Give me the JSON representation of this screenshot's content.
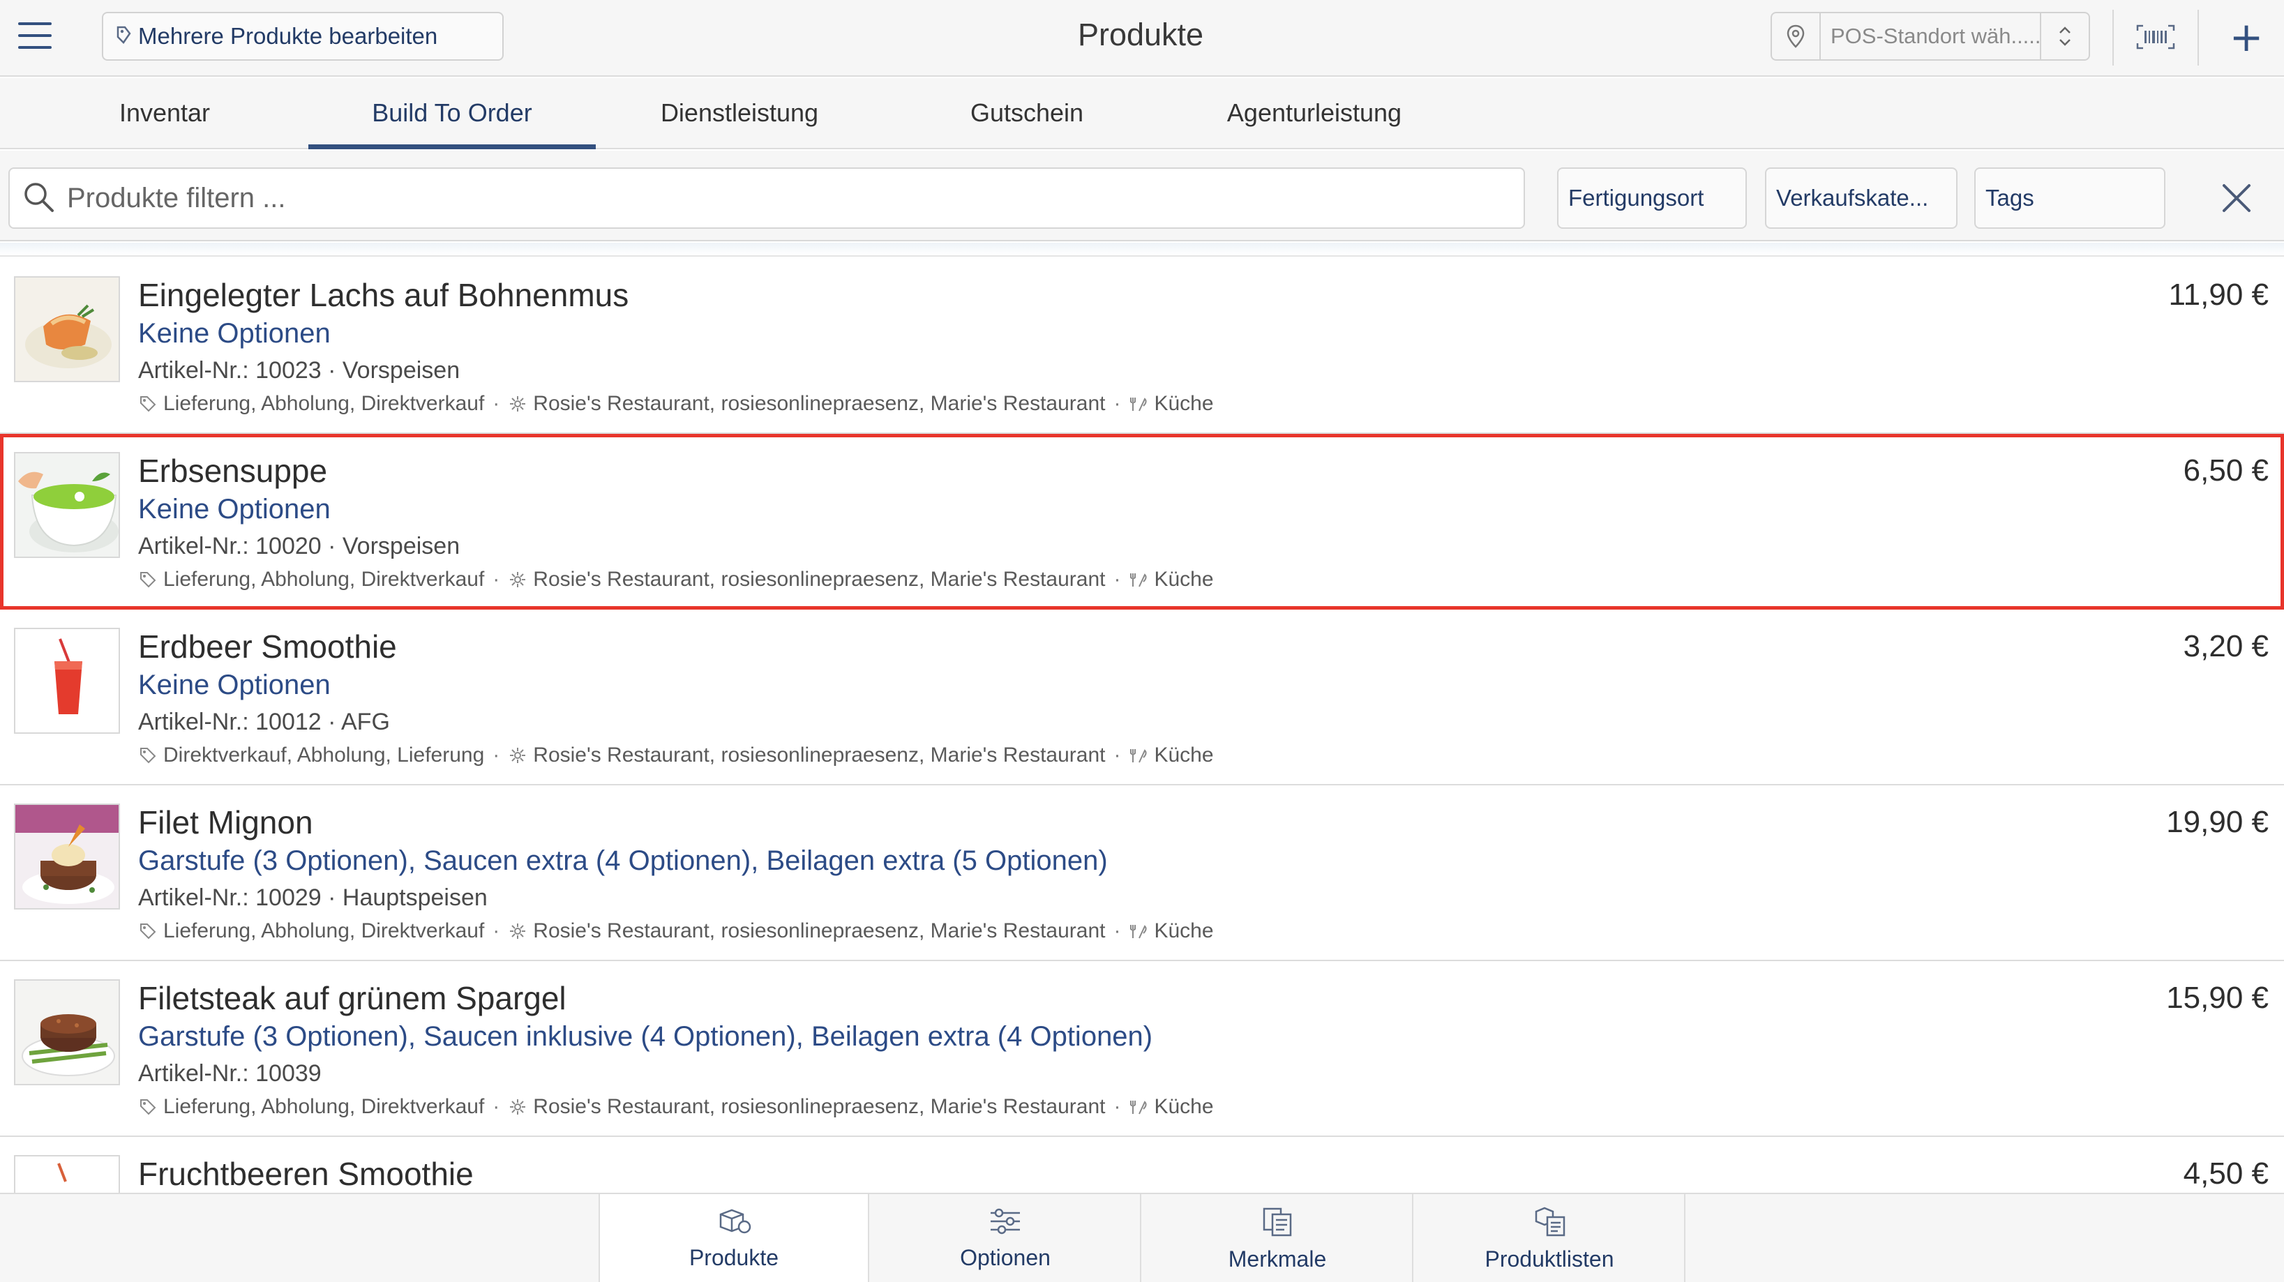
{
  "header": {
    "menu_icon": "hamburger-menu-icon",
    "bulk_edit_label": "Mehrere Produkte bearbeiten",
    "title": "Produkte",
    "pos_placeholder": "POS-Standort wäh.....",
    "barcode_icon": "barcode-icon",
    "add_icon": "plus-icon"
  },
  "tabs": [
    {
      "label": "Inventar",
      "active": false
    },
    {
      "label": "Build To Order",
      "active": true
    },
    {
      "label": "Dienstleistung",
      "active": false
    },
    {
      "label": "Gutschein",
      "active": false
    },
    {
      "label": "Agenturleistung",
      "active": false
    }
  ],
  "filters": {
    "search_placeholder": "Produkte filtern ...",
    "chips": [
      "Fertigungsort",
      "Verkaufskate...",
      "Tags"
    ],
    "clear_icon": "close-icon"
  },
  "products": [
    {
      "name": "Eingelegter Lachs auf Bohnenmus",
      "options": "Keine Optionen",
      "meta": "Artikel-Nr.: 10023 · Vorspeisen",
      "channels": "Lieferung, Abholung, Direktverkauf",
      "locations": "Rosie's Restaurant, rosiesonlinepraesenz, Marie's Restaurant",
      "production": "Küche",
      "price": "11,90 €",
      "selected": false
    },
    {
      "name": "Erbsensuppe",
      "options": "Keine Optionen",
      "meta": "Artikel-Nr.: 10020 · Vorspeisen",
      "channels": "Lieferung, Abholung, Direktverkauf",
      "locations": "Rosie's Restaurant, rosiesonlinepraesenz, Marie's Restaurant",
      "production": "Küche",
      "price": "6,50 €",
      "selected": true
    },
    {
      "name": "Erdbeer Smoothie",
      "options": "Keine Optionen",
      "meta": "Artikel-Nr.: 10012 · AFG",
      "channels": "Direktverkauf, Abholung, Lieferung",
      "locations": "Rosie's Restaurant, rosiesonlinepraesenz, Marie's Restaurant",
      "production": "Küche",
      "price": "3,20 €",
      "selected": false
    },
    {
      "name": "Filet Mignon",
      "options": "Garstufe (3 Optionen), Saucen extra (4 Optionen), Beilagen extra (5 Optionen)",
      "meta": "Artikel-Nr.: 10029 · Hauptspeisen",
      "channels": "Lieferung, Abholung, Direktverkauf",
      "locations": "Rosie's Restaurant, rosiesonlinepraesenz, Marie's Restaurant",
      "production": "Küche",
      "price": "19,90 €",
      "selected": false
    },
    {
      "name": "Filetsteak auf grünem Spargel",
      "options": "Garstufe (3 Optionen), Saucen inklusive (4 Optionen), Beilagen extra (4 Optionen)",
      "meta": "Artikel-Nr.: 10039",
      "channels": "Lieferung, Abholung, Direktverkauf",
      "locations": "Rosie's Restaurant, rosiesonlinepraesenz, Marie's Restaurant",
      "production": "Küche",
      "price": "15,90 €",
      "selected": false
    },
    {
      "name": "Fruchtbeeren Smoothie",
      "options": "",
      "meta": "",
      "channels": "",
      "locations": "",
      "production": "",
      "price": "4,50 €",
      "selected": false
    }
  ],
  "bottom_nav": [
    {
      "label": "Produkte",
      "icon": "products-icon",
      "active": true
    },
    {
      "label": "Optionen",
      "icon": "sliders-icon",
      "active": false
    },
    {
      "label": "Merkmale",
      "icon": "attributes-icon",
      "active": false
    },
    {
      "label": "Produktlisten",
      "icon": "product-lists-icon",
      "active": false
    }
  ],
  "colors": {
    "accent": "#33507f",
    "link": "#2c4b86",
    "selection": "#e8352b",
    "background": "#f6f6f6"
  }
}
